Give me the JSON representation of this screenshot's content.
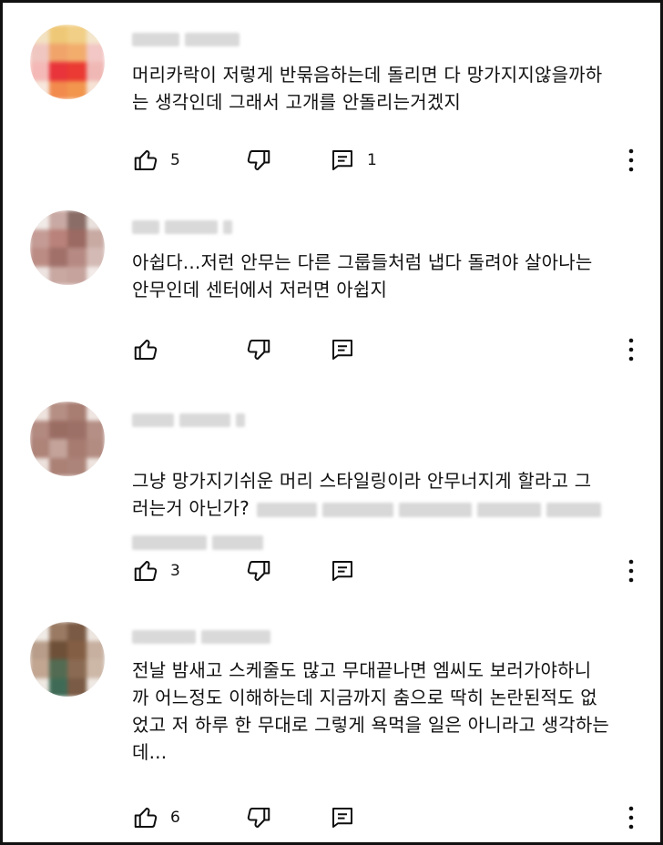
{
  "comments": [
    {
      "text": "머리카락이 저렇게 반묶음하는데 돌리면 다 망가지지않을까하\n는 생각인데 그래서 고개를 안돌리는거겠지",
      "likes": "5",
      "replies": "1"
    },
    {
      "text": "아쉽다...저런 안무는 다른 그룹들처럼 냅다 돌려야 살아나는\n안무인데 센터에서 저러면 아쉽지",
      "likes": "",
      "replies": ""
    },
    {
      "text": "그냥 망가지기쉬운 머리 스타일링이라 안무너지게 할라고 그\n러는거 아닌가?",
      "likes": "3",
      "replies": ""
    },
    {
      "text": "전날 밤새고 스케줄도 많고 무대끝나면 엠씨도 보러가야하니\n까 어느정도 이해하는데 지금까지 춤으로 딱히 논란된적도 없\n었고 저 하루 한 무대로 그렇게 욕먹을 일은 아니라고 생각하는\n데...",
      "likes": "6",
      "replies": ""
    }
  ],
  "icons": {
    "like": "thumbs-up-icon",
    "dislike": "thumbs-down-icon",
    "reply": "comment-icon",
    "more": "more-vertical-icon"
  }
}
